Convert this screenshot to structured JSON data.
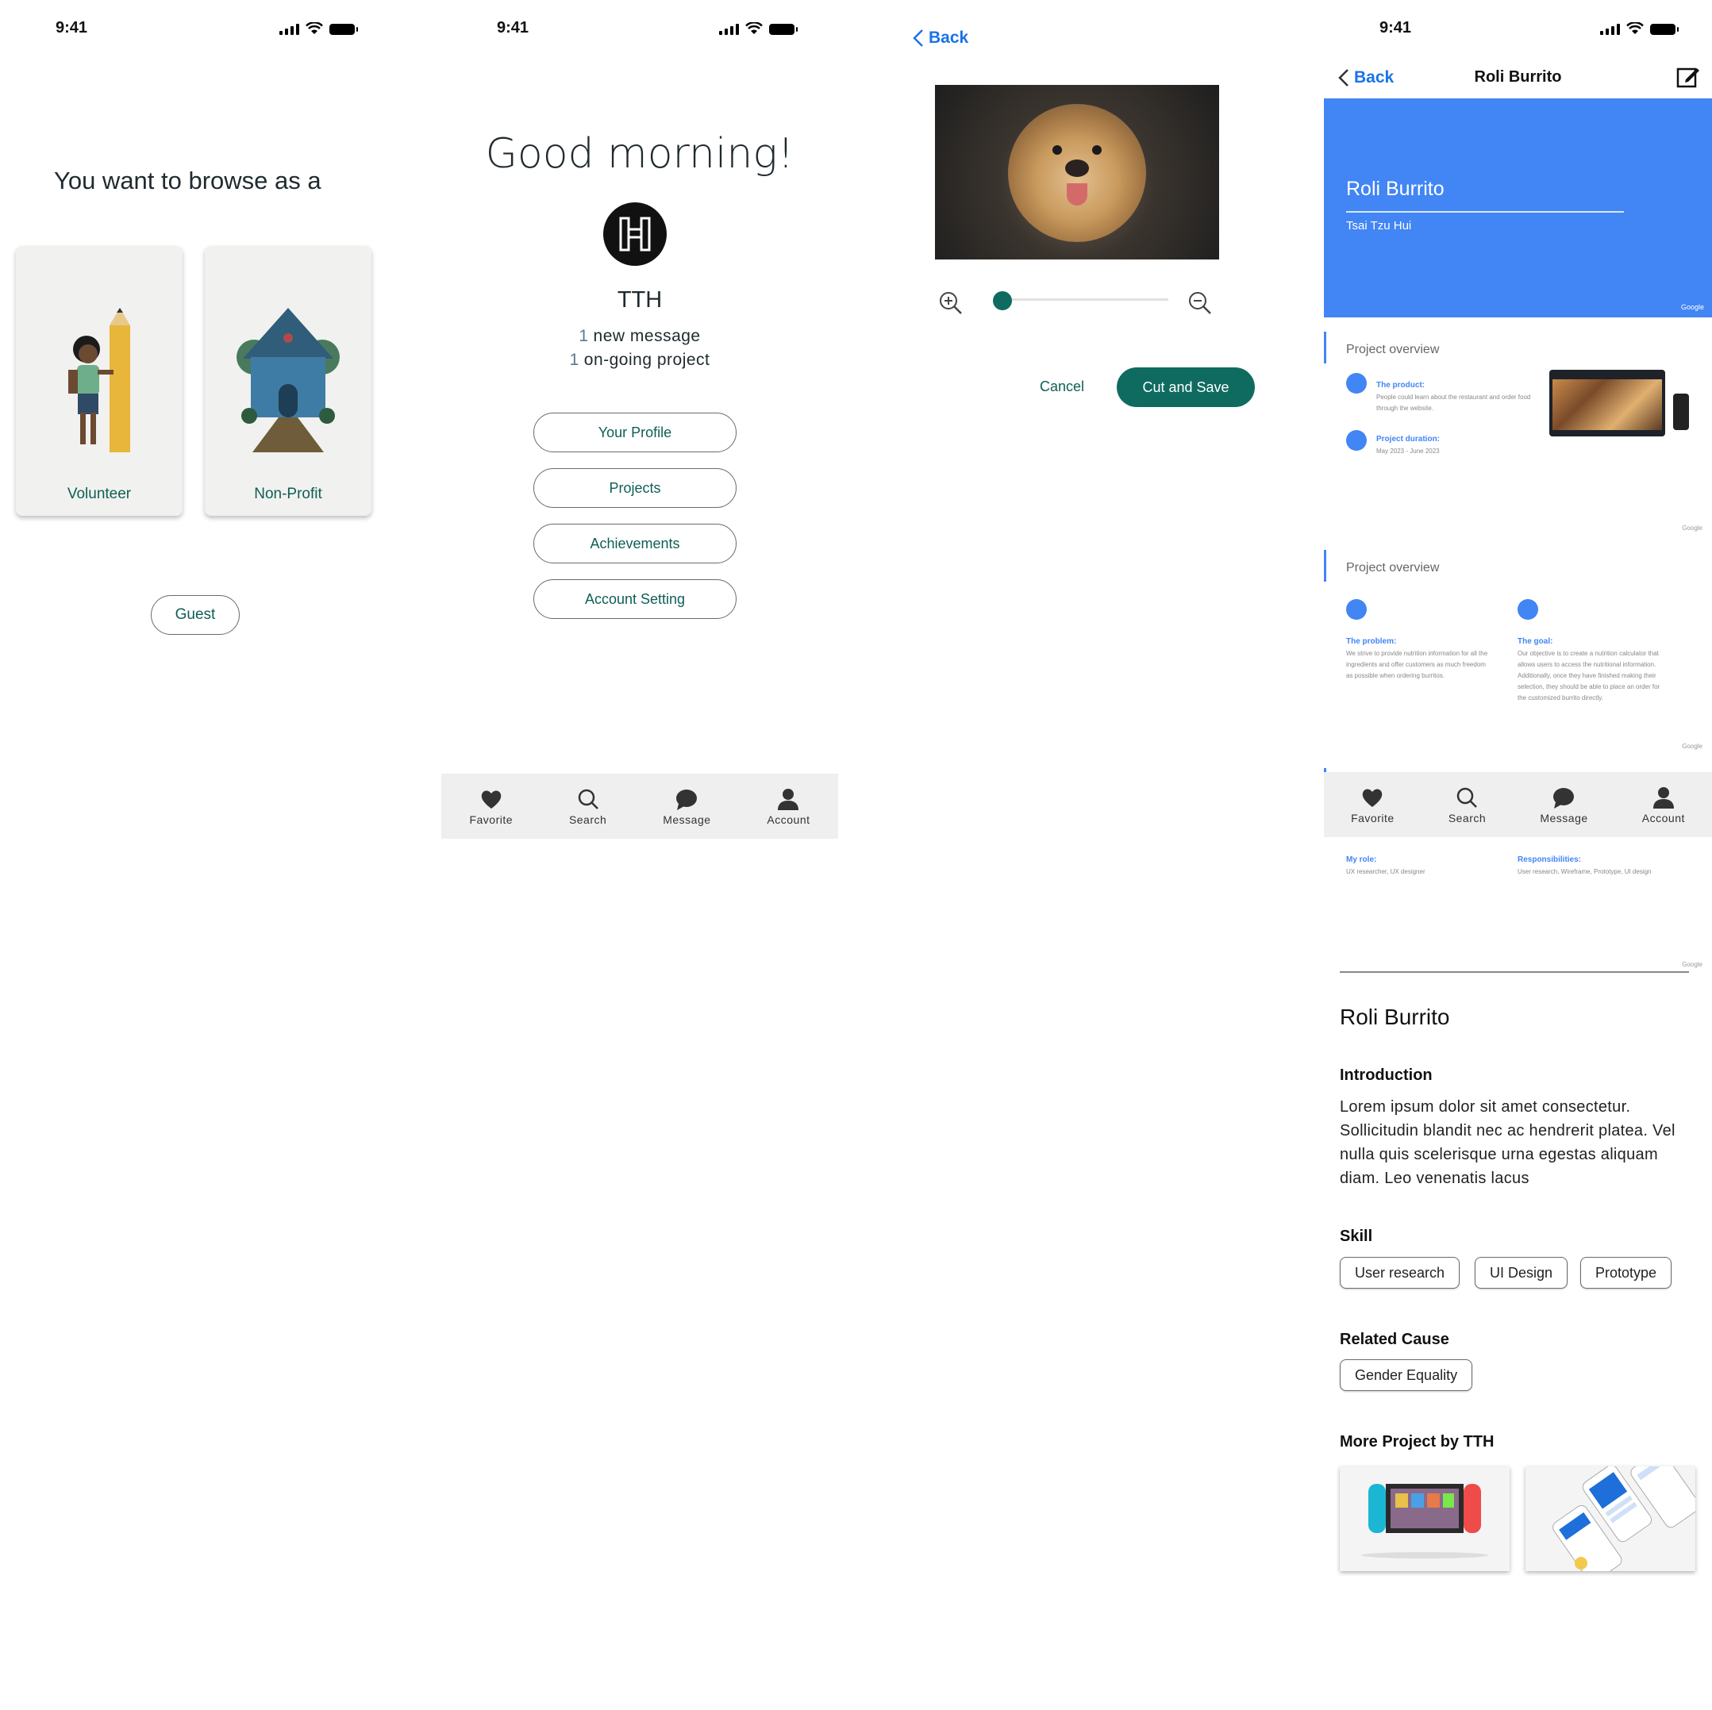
{
  "status_time": "9:41",
  "screen1": {
    "heading": "You want to browse as a",
    "cards": [
      {
        "label": "Volunteer"
      },
      {
        "label": "Non-Profit"
      }
    ],
    "guest_label": "Guest"
  },
  "screen2": {
    "greeting": "Good morning!",
    "user_name": "TTH",
    "messages_count": "1",
    "messages_text": "new message",
    "projects_count": "1",
    "projects_text": "on-going project",
    "menu": {
      "profile": "Your Profile",
      "projects": "Projects",
      "achievements": "Achievements",
      "account_setting": "Account Setting"
    }
  },
  "tabbar": {
    "favorite": "Favorite",
    "search": "Search",
    "message": "Message",
    "account": "Account"
  },
  "screen3": {
    "back_label": "Back",
    "zoom_level": 0.05,
    "cancel_label": "Cancel",
    "save_label": "Cut and Save"
  },
  "screen4": {
    "back_label": "Back",
    "title": "Roli Burrito",
    "cover": {
      "title": "Roli Burrito",
      "author": "Tsai Tzu Hui",
      "brand": "Google"
    },
    "slide1": {
      "title": "Project overview",
      "product_h": "The product:",
      "product_p": "People could learn about the restaurant and order food through the website.",
      "duration_h": "Project duration:",
      "duration_p": "May 2023 - June 2023",
      "brand": "Google"
    },
    "slide2": {
      "title": "Project overview",
      "problem_h": "The problem:",
      "problem_p": "We strive to provide nutrition information for all the ingredients and offer customers as much freedom as possible when ordering burritos.",
      "goal_h": "The goal:",
      "goal_p": "Our objective is to create a nutrition calculator that allows users to access the nutritional information. Additionally, once they have finished making their selection, they should be able to place an order for the customized burrito directly.",
      "brand": "Google"
    },
    "slide3": {
      "role_h": "My role:",
      "role_p": "UX researcher, UX designer",
      "resp_h": "Responsibilities:",
      "resp_p": "User research, Wireframe, Prototype, UI design",
      "brand": "Google"
    },
    "project_name": "Roli Burrito",
    "intro_heading": "Introduction",
    "intro_text": "Lorem ipsum dolor sit amet consectetur. Sollicitudin blandit nec ac hendrerit platea. Vel nulla quis scelerisque urna egestas aliquam diam. Leo venenatis lacus",
    "skill_heading": "Skill",
    "skills": [
      "User research",
      "UI Design",
      "Prototype"
    ],
    "cause_heading": "Related Cause",
    "causes": [
      "Gender Equality"
    ],
    "more_heading": "More Project by  TTH"
  },
  "colors": {
    "teal": "#0f6b60",
    "blue": "#1a73e8",
    "google_blue": "#4285f4",
    "tab_bg": "#efefef"
  }
}
